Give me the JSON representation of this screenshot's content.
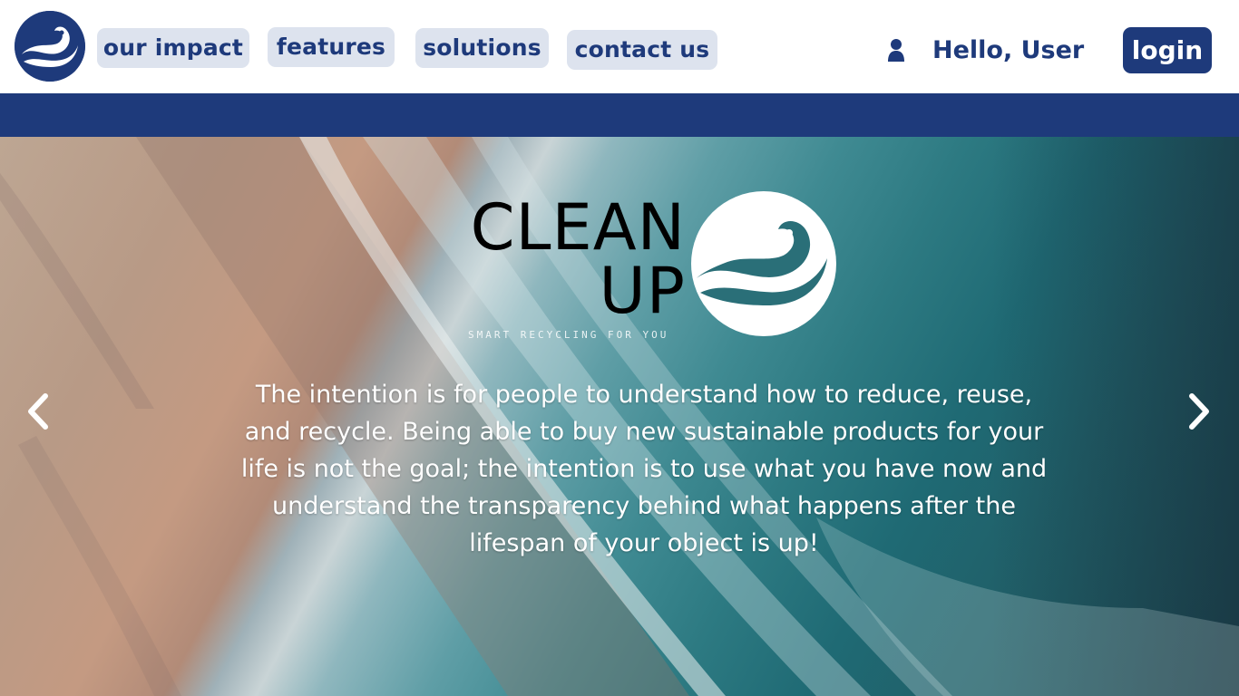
{
  "brand": {
    "logo_icon": "wave-icon",
    "name_line1": "CLEAN",
    "name_line2": "UP",
    "tagline": "SMART RECYCLING FOR YOU"
  },
  "nav": {
    "items": [
      {
        "label": "our impact"
      },
      {
        "label": "features"
      },
      {
        "label": "solutions"
      },
      {
        "label": "contact us"
      }
    ]
  },
  "user": {
    "icon": "user-icon",
    "greeting": "Hello, User",
    "login_label": "login"
  },
  "hero": {
    "description": "The intention is for people to understand how to reduce, reuse, and recycle. Being able to buy new sustainable products for your life is not the goal; the intention is to use what you have now and understand the transparency behind what happens after the lifespan of your object is up!",
    "prev_icon": "chevron-left-icon",
    "next_icon": "chevron-right-icon"
  },
  "colors": {
    "brand_navy": "#1e3a7b",
    "nav_button_bg": "#dde3ee",
    "white": "#ffffff"
  }
}
